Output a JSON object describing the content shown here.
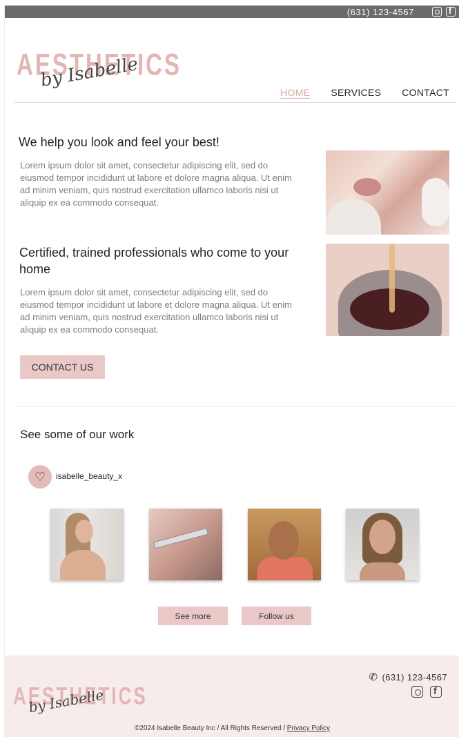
{
  "topbar": {
    "phone": "(631) 123-4567",
    "icons": [
      "instagram-icon",
      "facebook-icon"
    ]
  },
  "logo": {
    "word": "AESTHETICS",
    "script": "by Isabelle"
  },
  "nav": {
    "items": [
      {
        "label": "HOME",
        "active": true
      },
      {
        "label": "SERVICES"
      },
      {
        "label": "CONTACT"
      }
    ]
  },
  "hero": [
    {
      "heading": "We help you look and feel your best!",
      "body": "Lorem ipsum dolor sit amet, consectetur adipiscing elit, sed do eiusmod tempor incididunt ut labore et dolore magna aliqua. Ut enim ad minim veniam, quis nostrud exercitation ullamco laboris nisi ut aliquip ex ea commodo consequat."
    },
    {
      "heading": "Certified, trained professionals who come to your home",
      "body": "Lorem ipsum dolor sit amet, consectetur adipiscing elit, sed do eiusmod tempor incididunt ut labore et dolore magna aliqua. Ut enim ad minim veniam, quis nostrud exercitation ullamco laboris nisi ut aliquip ex ea commodo consequat."
    }
  ],
  "contact_button": "CONTACT US",
  "work": {
    "heading": "See some of our work",
    "handle": "isabelle_beauty_x",
    "see_more": "See more",
    "follow_us": "Follow us"
  },
  "footer": {
    "phone": "(631) 123-4567",
    "copyright": "©2024 Isabelle Beauty Inc / All Rights Reserved / ",
    "privacy": "Privacy Policy"
  },
  "colors": {
    "accent_pink": "#e9c8c7",
    "logo_pink": "#e5b5b3",
    "topbar": "#6b6b6e",
    "footer_bg": "#f7ecec"
  }
}
